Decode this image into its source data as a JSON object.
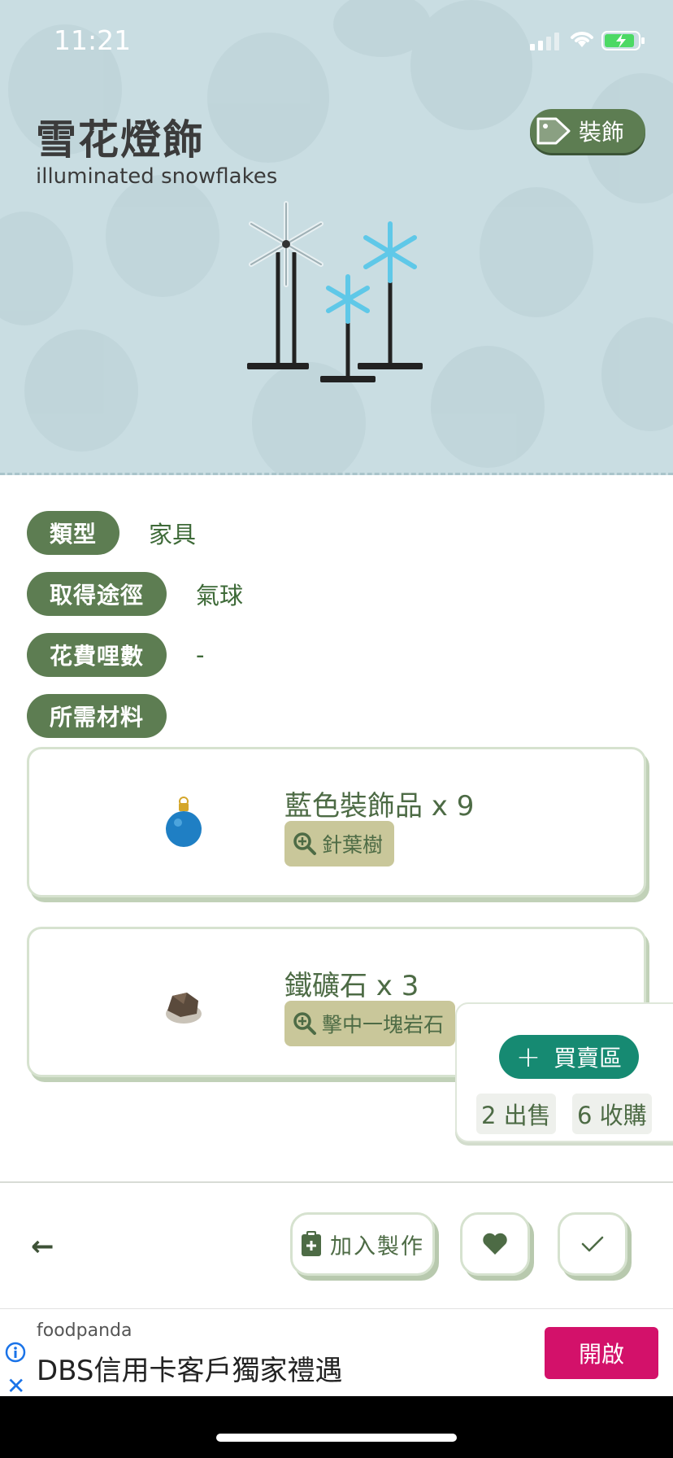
{
  "status_bar": {
    "time": "11:21"
  },
  "item": {
    "name": "雪花燈飾",
    "name_en": "illuminated snowflakes",
    "tag_label": "裝飾"
  },
  "info": [
    {
      "label": "類型",
      "value": "家具"
    },
    {
      "label": "取得途徑",
      "value": "氣球"
    },
    {
      "label": "花費哩數",
      "value": "-"
    },
    {
      "label": "所需材料",
      "value": ""
    }
  ],
  "materials": [
    {
      "name": "藍色裝飾品 x 9",
      "source": "針葉樹",
      "icon": "blue-ornament-icon"
    },
    {
      "name": "鐵礦石 x 3",
      "source": "擊中一塊岩石",
      "icon": "iron-nugget-icon"
    }
  ],
  "trade": {
    "button_label": "買賣區",
    "sell_label": "2 出售",
    "buy_label": "6 收購"
  },
  "actions": {
    "craft_label": "加入製作"
  },
  "ad": {
    "brand": "foodpanda",
    "headline": "DBS信用卡客戶獨家禮遇",
    "cta": "開啟"
  },
  "colors": {
    "hero_bg": "#c9dde2",
    "pill_green": "#5d7d52",
    "trade_teal": "#168a72",
    "ad_pink": "#d3116a"
  }
}
